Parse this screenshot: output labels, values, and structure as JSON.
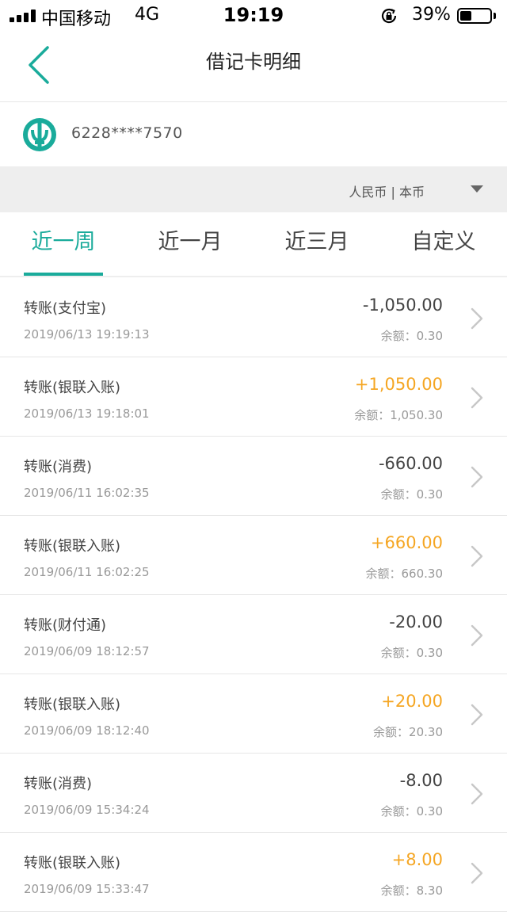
{
  "status_bar": {
    "carrier": "中国移动",
    "network": "4G",
    "time": "19:19",
    "battery_percent": "39%",
    "battery_level": 0.39
  },
  "header": {
    "title": "借记卡明细",
    "back_icon": "chevron-left-icon"
  },
  "account": {
    "logo_icon": "bank-logo-icon",
    "card_number": "6228****7570"
  },
  "currency": {
    "label": "人民币 | 本币",
    "icon": "caret-down-icon"
  },
  "tabs": [
    {
      "label": "近一周",
      "active": true
    },
    {
      "label": "近一月",
      "active": false
    },
    {
      "label": "近三月",
      "active": false
    },
    {
      "label": "自定义",
      "active": false
    }
  ],
  "transactions": [
    {
      "title": "转账(支付宝)",
      "date": "2019/06/13 19:19:13",
      "amount": "-1,050.00",
      "balance": "余额：0.30",
      "type": "debit"
    },
    {
      "title": "转账(银联入账)",
      "date": "2019/06/13 19:18:01",
      "amount": "+1,050.00",
      "balance": "余额：1,050.30",
      "type": "credit"
    },
    {
      "title": "转账(消费)",
      "date": "2019/06/11 16:02:35",
      "amount": "-660.00",
      "balance": "余额：0.30",
      "type": "debit"
    },
    {
      "title": "转账(银联入账)",
      "date": "2019/06/11 16:02:25",
      "amount": "+660.00",
      "balance": "余额：660.30",
      "type": "credit"
    },
    {
      "title": "转账(财付通)",
      "date": "2019/06/09 18:12:57",
      "amount": "-20.00",
      "balance": "余额：0.30",
      "type": "debit"
    },
    {
      "title": "转账(银联入账)",
      "date": "2019/06/09 18:12:40",
      "amount": "+20.00",
      "balance": "余额：20.30",
      "type": "credit"
    },
    {
      "title": "转账(消费)",
      "date": "2019/06/09 15:34:24",
      "amount": "-8.00",
      "balance": "余额：0.30",
      "type": "debit"
    },
    {
      "title": "转账(银联入账)",
      "date": "2019/06/09 15:33:47",
      "amount": "+8.00",
      "balance": "余额：8.30",
      "type": "credit"
    }
  ],
  "colors": {
    "accent": "#1aab9b",
    "credit": "#f5a623",
    "debit": "#444444"
  }
}
